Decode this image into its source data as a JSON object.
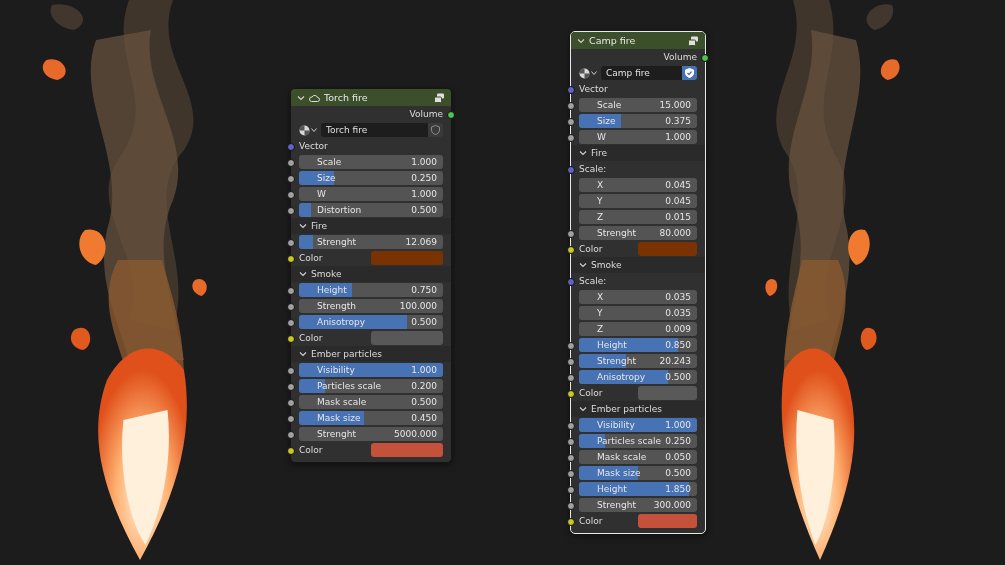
{
  "nodes": [
    {
      "title": "Torch fire",
      "has_icon": true,
      "selected": false,
      "output": "Volume",
      "datablock": {
        "value": "Torch fire",
        "fake_user": false
      },
      "rows": [
        {
          "kind": "vector_input",
          "label": "Vector"
        },
        {
          "kind": "number",
          "label": "Scale",
          "value": "1.000"
        },
        {
          "kind": "value",
          "label": "Size",
          "value": "0.250",
          "level": 0.24
        },
        {
          "kind": "number",
          "label": "W",
          "value": "1.000"
        },
        {
          "kind": "value",
          "label": "Distortion",
          "value": "0.500",
          "level": 0.08
        },
        {
          "kind": "panel",
          "label": "Fire",
          "expanded": true,
          "rows": [
            {
              "kind": "value",
              "label": "Strenght",
              "value": "12.069",
              "level": 0.1
            },
            {
              "kind": "color",
              "label": "Color",
              "color": "#7a3300"
            }
          ]
        },
        {
          "kind": "panel",
          "label": "Smoke",
          "expanded": true,
          "rows": [
            {
              "kind": "value",
              "label": "Height",
              "value": "0.750",
              "level": 0.37
            },
            {
              "kind": "number",
              "label": "Strength",
              "value": "100.000"
            },
            {
              "kind": "value",
              "label": "Anisotropy",
              "value": "0.500",
              "level": 0.75
            },
            {
              "kind": "color",
              "label": "Color",
              "color": "#585858"
            }
          ]
        },
        {
          "kind": "panel",
          "label": "Ember particles",
          "expanded": true,
          "rows": [
            {
              "kind": "value",
              "label": "Visibility",
              "value": "1.000",
              "level": 1
            },
            {
              "kind": "value",
              "label": "Particles scale",
              "value": "0.200",
              "level": 0.18
            },
            {
              "kind": "number",
              "label": "Mask scale",
              "value": "0.500"
            },
            {
              "kind": "value",
              "label": "Mask size",
              "value": "0.450",
              "level": 0.45
            },
            {
              "kind": "number",
              "label": "Strenght",
              "value": "5000.000"
            },
            {
              "kind": "color",
              "label": "Color",
              "color": "#c4513a"
            }
          ]
        }
      ]
    },
    {
      "title": "Camp fire",
      "has_icon": false,
      "selected": true,
      "output": "Volume",
      "datablock": {
        "value": "Camp fire",
        "fake_user": true
      },
      "rows": [
        {
          "kind": "vector_input",
          "label": "Vector"
        },
        {
          "kind": "number",
          "label": "Scale",
          "value": "15.000"
        },
        {
          "kind": "value",
          "label": "Size",
          "value": "0.375",
          "level": 0.36
        },
        {
          "kind": "number",
          "label": "W",
          "value": "1.000"
        },
        {
          "kind": "panel",
          "label": "Fire",
          "expanded": true,
          "rows": [
            {
              "kind": "vector_input",
              "label": "Scale:"
            },
            {
              "kind": "component",
              "label": "X",
              "value": "0.045"
            },
            {
              "kind": "component",
              "label": "Y",
              "value": "0.045"
            },
            {
              "kind": "component",
              "label": "Z",
              "value": "0.015"
            },
            {
              "kind": "number",
              "label": "Strenght",
              "value": "80.000"
            },
            {
              "kind": "color",
              "label": "Color",
              "color": "#7a3300"
            }
          ]
        },
        {
          "kind": "panel",
          "label": "Smoke",
          "expanded": true,
          "rows": [
            {
              "kind": "vector_input",
              "label": "Scale:"
            },
            {
              "kind": "component",
              "label": "X",
              "value": "0.035"
            },
            {
              "kind": "component",
              "label": "Y",
              "value": "0.035"
            },
            {
              "kind": "component",
              "label": "Z",
              "value": "0.009"
            },
            {
              "kind": "value",
              "label": "Height",
              "value": "0.850",
              "level": 0.84
            },
            {
              "kind": "value",
              "label": "Strenght",
              "value": "20.243",
              "level": 0.4
            },
            {
              "kind": "value",
              "label": "Anisotropy",
              "value": "0.500",
              "level": 0.75
            },
            {
              "kind": "color",
              "label": "Color",
              "color": "#595959"
            }
          ]
        },
        {
          "kind": "panel",
          "label": "Ember particles",
          "expanded": true,
          "rows": [
            {
              "kind": "value",
              "label": "Visibility",
              "value": "1.000",
              "level": 1
            },
            {
              "kind": "value",
              "label": "Particles scale",
              "value": "0.250",
              "level": 0.22
            },
            {
              "kind": "number",
              "label": "Mask scale",
              "value": "0.050"
            },
            {
              "kind": "value",
              "label": "Mask size",
              "value": "0.500",
              "level": 0.5
            },
            {
              "kind": "value",
              "label": "Height",
              "value": "1.850",
              "level": 0.93
            },
            {
              "kind": "number",
              "label": "Strenght",
              "value": "300.000"
            },
            {
              "kind": "color",
              "label": "Color",
              "color": "#c4513a"
            }
          ]
        }
      ]
    }
  ]
}
